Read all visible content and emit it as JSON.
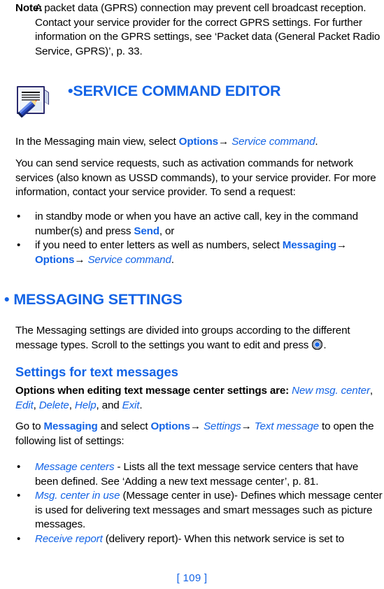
{
  "note": {
    "label": "Note:",
    "body_pre": "A packet data (GPRS) connection may prevent cell broadcast reception. Contact your service provider for the correct GPRS settings. For further information on the GPRS settings, see ",
    "body_ref": "‘Packet data (General Packet Radio Service, GPRS)’",
    "body_post": ", p. 33."
  },
  "service_section": {
    "icon": "notepad-pencil-icon",
    "bullet": "•",
    "heading": "SERVICE COMMAND EDITOR",
    "intro_pre": "In the Messaging main view, select ",
    "intro_options": "Options",
    "intro_arrow": "→",
    "intro_service_command": "Service command",
    "intro_post": ".",
    "body": "You can send service requests, such as activation commands for network services (also known as USSD commands), to your service provider. For more information, contact your service provider. To send a request:",
    "bullets": [
      {
        "marker": "•",
        "pre": "in standby mode or when you have an active call, key in the command number(s) and press ",
        "emphasis": "Send",
        "post": ", or"
      },
      {
        "marker": "•",
        "pre": "if you need to enter letters as well as numbers, select ",
        "emphasis": "Messaging",
        "arrow1": "→",
        "emphasis2": "Options",
        "arrow2": "→",
        "italic": "Service command",
        "post": "."
      }
    ]
  },
  "messaging_settings": {
    "bullet": "•",
    "heading": "MESSAGING SETTINGS",
    "intro_pre": "The Messaging settings are divided into groups according to the different message types. Scroll to the settings you want to edit and press ",
    "intro_icon": "scroll-key-icon",
    "intro_post": ".",
    "subheading": "Settings for text messages",
    "options_pre": "Options when editing text message center settings are: ",
    "options_items": [
      "New msg. center",
      "Edit",
      "Delete",
      "Help",
      "Exit"
    ],
    "options_sep": ", ",
    "options_and": ", and ",
    "options_post": ".",
    "goto_pre": "Go to ",
    "goto_messaging": "Messaging",
    "goto_mid": " and select ",
    "goto_options": "Options",
    "goto_arrow1": "→",
    "goto_settings": "Settings",
    "goto_arrow2": "→",
    "goto_text_message": "Text message",
    "goto_post": " to open the following list of settings:",
    "bullets": [
      {
        "marker": "•",
        "term": "Message centers",
        "pre": " - Lists all the text message service centers that have been defined. See ",
        "ref": "‘Adding a new text message center’",
        "post": ", p. 81."
      },
      {
        "marker": "•",
        "term": "Msg. center in use",
        "pre": " (Message center in use)- Defines which message center is used for delivering text messages and smart messages such as picture messages.",
        "ref": "",
        "post": ""
      },
      {
        "marker": "•",
        "term": "Receive report",
        "pre": " (delivery report)- When this network service is set to",
        "ref": "",
        "post": ""
      }
    ]
  },
  "footer": {
    "page_number": "[ 109 ]"
  },
  "colors": {
    "accent_blue": "#1464e6",
    "text_black": "#000000",
    "page_background": "#ffffff"
  }
}
